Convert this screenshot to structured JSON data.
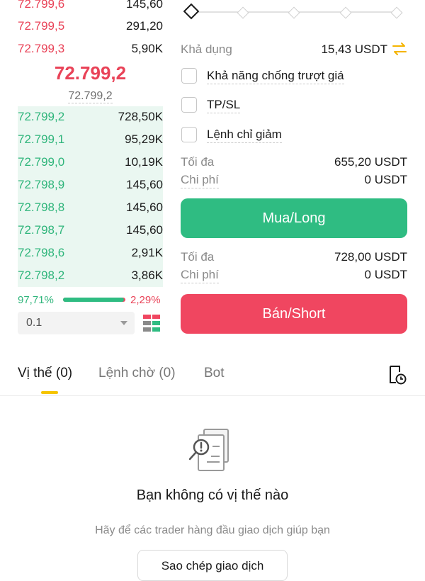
{
  "orderbook": {
    "asks": [
      {
        "price": "72.799,6",
        "qty": "145,60"
      },
      {
        "price": "72.799,5",
        "qty": "291,20"
      },
      {
        "price": "72.799,3",
        "qty": "5,90K"
      }
    ],
    "last_price": "72.799,2",
    "mark_price": "72.799,2",
    "bids": [
      {
        "price": "72.799,2",
        "qty": "728,50K"
      },
      {
        "price": "72.799,1",
        "qty": "95,29K"
      },
      {
        "price": "72.799,0",
        "qty": "10,19K"
      },
      {
        "price": "72.798,9",
        "qty": "145,60"
      },
      {
        "price": "72.798,8",
        "qty": "145,60"
      },
      {
        "price": "72.798,7",
        "qty": "145,60"
      },
      {
        "price": "72.798,6",
        "qty": "2,91K"
      },
      {
        "price": "72.798,2",
        "qty": "3,86K"
      }
    ],
    "buy_ratio": "97,71%",
    "sell_ratio": "2,29%",
    "buy_ratio_value": 0.9771,
    "precision": "0.1"
  },
  "order_form": {
    "available_label": "Khả dụng",
    "available_value": "15,43 USDT",
    "options": [
      {
        "label": "Khả năng chống trượt giá"
      },
      {
        "label": "TP/SL"
      },
      {
        "label": "Lệnh chỉ giảm"
      }
    ],
    "long": {
      "max_label": "Tối đa",
      "max_value": "655,20 USDT",
      "cost_label": "Chi phí",
      "cost_value": "0 USDT",
      "button": "Mua/Long"
    },
    "short": {
      "max_label": "Tối đa",
      "max_value": "728,00 USDT",
      "cost_label": "Chi phí",
      "cost_value": "0 USDT",
      "button": "Bán/Short"
    }
  },
  "tabs": [
    {
      "label": "Vị thế (0)"
    },
    {
      "label": "Lệnh chờ (0)"
    },
    {
      "label": "Bot"
    }
  ],
  "empty_state": {
    "title": "Bạn không có vị thế nào",
    "subtitle": "Hãy để các trader hàng đầu giao dịch giúp bạn",
    "button": "Sao chép giao dịch"
  },
  "colors": {
    "buy": "#2fbc82",
    "sell": "#f04660",
    "accent": "#f5c400"
  }
}
